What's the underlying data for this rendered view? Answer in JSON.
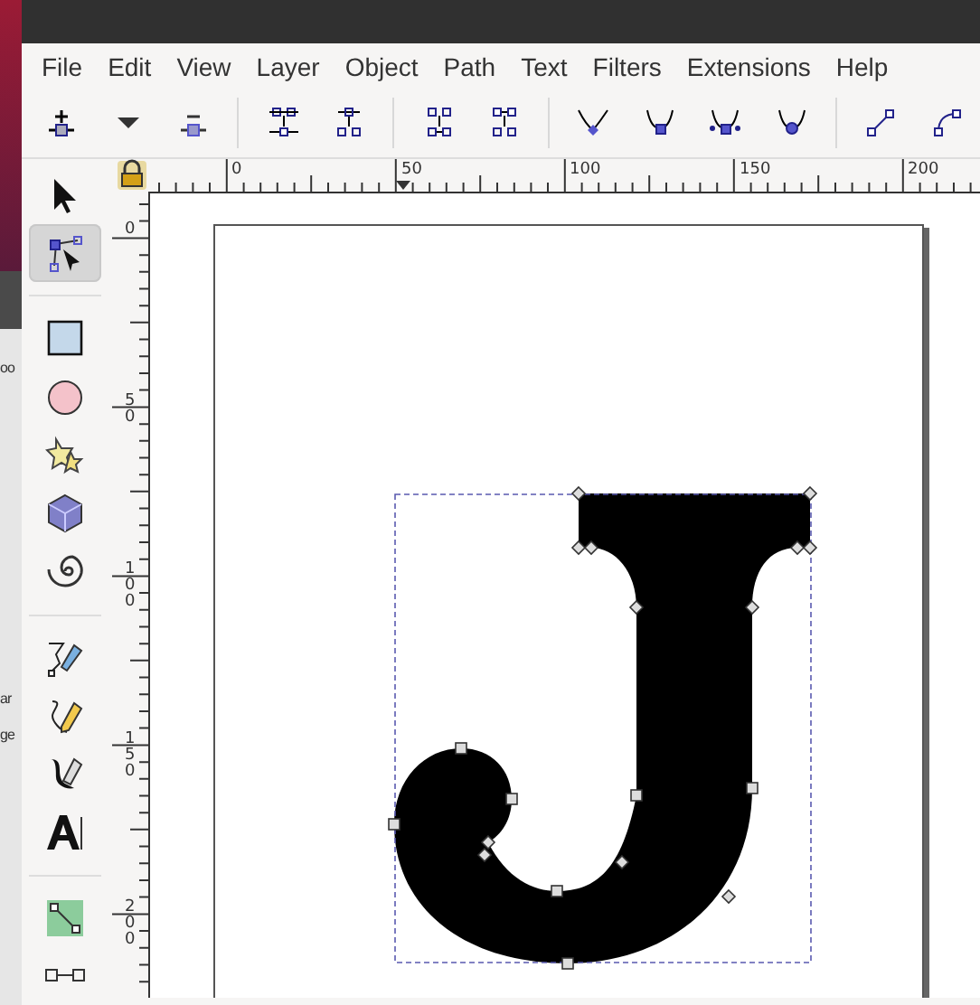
{
  "background_window": {
    "fragments": [
      "oo",
      "ar",
      "ge"
    ]
  },
  "menu": [
    "File",
    "Edit",
    "View",
    "Layer",
    "Object",
    "Path",
    "Text",
    "Filters",
    "Extensions",
    "Help"
  ],
  "toolbar": [
    {
      "kind": "node-add"
    },
    {
      "kind": "caret"
    },
    {
      "kind": "node-remove"
    },
    {
      "kind": "sep"
    },
    {
      "kind": "join"
    },
    {
      "kind": "break"
    },
    {
      "kind": "sep"
    },
    {
      "kind": "join-segment"
    },
    {
      "kind": "delete-segment"
    },
    {
      "kind": "sep"
    },
    {
      "kind": "cusp"
    },
    {
      "kind": "smooth"
    },
    {
      "kind": "symmetric"
    },
    {
      "kind": "auto"
    },
    {
      "kind": "sep"
    },
    {
      "kind": "line"
    },
    {
      "kind": "curve"
    }
  ],
  "tools": [
    {
      "kind": "selector",
      "selected": false
    },
    {
      "kind": "node",
      "selected": true
    },
    {
      "kind": "sep"
    },
    {
      "kind": "rect",
      "selected": false
    },
    {
      "kind": "ellipse",
      "selected": false
    },
    {
      "kind": "star",
      "selected": false
    },
    {
      "kind": "box3d",
      "selected": false
    },
    {
      "kind": "spiral",
      "selected": false
    },
    {
      "kind": "sep"
    },
    {
      "kind": "pen",
      "selected": false
    },
    {
      "kind": "pencil",
      "selected": false
    },
    {
      "kind": "calligraphy",
      "selected": false
    },
    {
      "kind": "text",
      "selected": false
    },
    {
      "kind": "sep"
    },
    {
      "kind": "connector",
      "selected": false
    },
    {
      "kind": "dropper",
      "selected": false
    }
  ],
  "horizontal_ruler": {
    "labels": [
      "0",
      "50",
      "100",
      "150",
      "200"
    ]
  },
  "vertical_ruler": {
    "labels": [
      "0",
      "50",
      "100",
      "150",
      "200"
    ]
  }
}
